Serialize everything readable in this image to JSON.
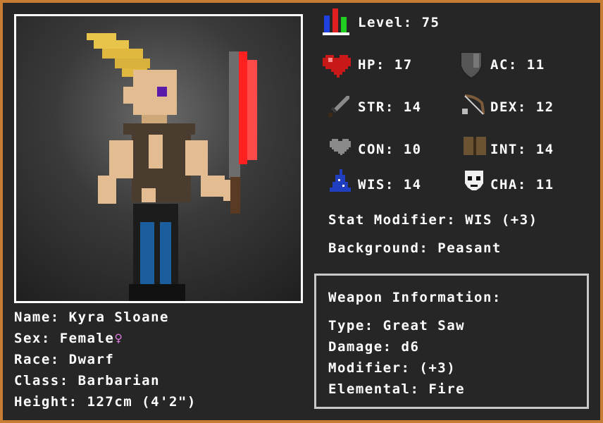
{
  "character": {
    "name_line": "Name: Kyra Sloane",
    "sex_line": "Sex: Female",
    "sex_symbol": "♀",
    "race_line": "Race: Dwarf",
    "class_line": "Class: Barbarian",
    "height_line": "Height: 127cm (4'2\")"
  },
  "stats": {
    "level": "Level: 75",
    "hp": "HP: 17",
    "ac": "AC: 11",
    "str": "STR: 14",
    "dex": "DEX: 12",
    "con": "CON: 10",
    "int": "INT: 14",
    "wis": "WIS: 14",
    "cha": "CHA: 11",
    "stat_modifier": "Stat Modifier: WIS (+3)",
    "background": "Background: Peasant"
  },
  "weapon": {
    "heading": "Weapon Information:",
    "type": "Type: Great Saw",
    "damage": "Damage: d6",
    "modifier": "Modifier: (+3)",
    "elemental": "Elemental: Fire"
  },
  "colors": {
    "frame": "#c87d35",
    "panel": "#262626",
    "text": "#ffffff",
    "female_symbol": "#e07ce0",
    "weapon_blade": "#ff2020"
  }
}
